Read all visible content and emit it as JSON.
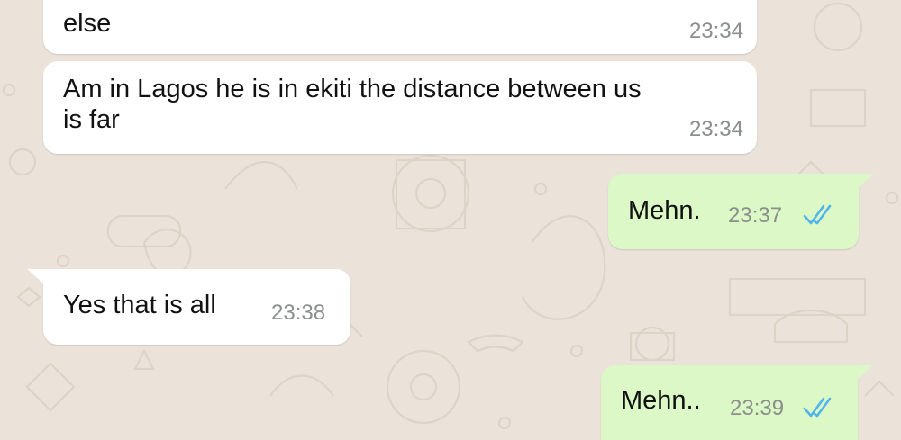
{
  "messages": [
    {
      "id": "m1",
      "direction": "incoming",
      "text": "else",
      "time": "23:34"
    },
    {
      "id": "m2",
      "direction": "incoming",
      "text": "Am in Lagos he is in ekiti the distance between us\nis far",
      "time": "23:34"
    },
    {
      "id": "m3",
      "direction": "outgoing",
      "text": "Mehn.",
      "time": "23:37",
      "status": "read"
    },
    {
      "id": "m4",
      "direction": "incoming",
      "text": "Yes that is all",
      "time": "23:38"
    },
    {
      "id": "m5",
      "direction": "outgoing",
      "text": "Mehn..",
      "time": "23:39",
      "status": "read"
    }
  ],
  "colors": {
    "incoming_bubble": "#ffffff",
    "outgoing_bubble": "#dcf8c6",
    "read_ticks": "#4fb6ec",
    "chat_background": "#ebe3da"
  },
  "icons": {
    "read_status": "double-check-icon"
  }
}
